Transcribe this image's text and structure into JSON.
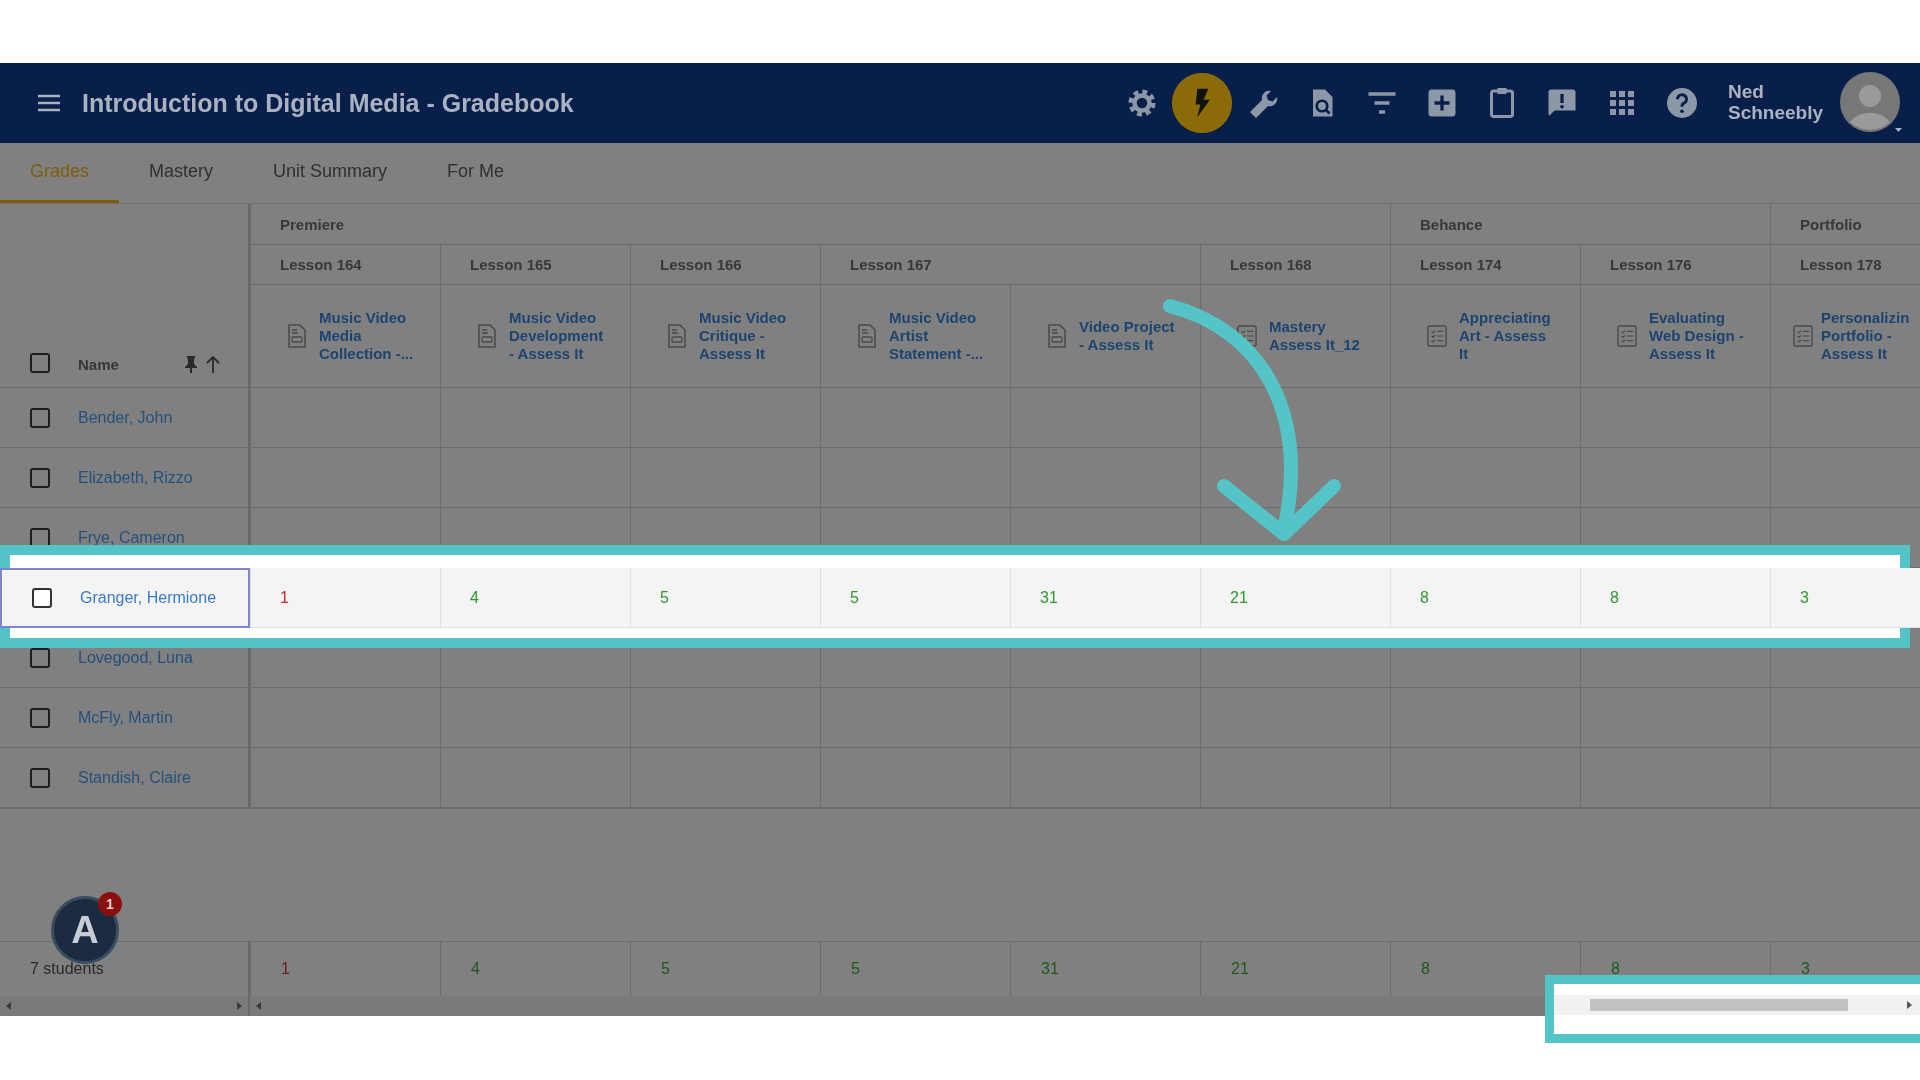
{
  "header": {
    "title": "Introduction to Digital Media - Gradebook",
    "user_name": "Ned Schneebly",
    "toolbar": [
      {
        "kind": "settings",
        "highlighted": false
      },
      {
        "kind": "lightning",
        "highlighted": true
      },
      {
        "kind": "wrench",
        "highlighted": false
      },
      {
        "kind": "document-search",
        "highlighted": false
      },
      {
        "kind": "filter",
        "highlighted": false
      },
      {
        "kind": "plus",
        "highlighted": false
      },
      {
        "kind": "clipboard",
        "highlighted": false
      },
      {
        "kind": "feedback",
        "highlighted": false
      },
      {
        "kind": "apps",
        "highlighted": false
      },
      {
        "kind": "help",
        "highlighted": false
      }
    ]
  },
  "tabs": [
    {
      "label": "Grades",
      "selected": true
    },
    {
      "label": "Mastery",
      "selected": false
    },
    {
      "label": "Unit Summary",
      "selected": false
    },
    {
      "label": "For Me",
      "selected": false
    }
  ],
  "table": {
    "name_header": "Name",
    "select_all_checked": false,
    "groups": [
      {
        "label": "Premiere",
        "lessons": [
          {
            "label": "Lesson 164",
            "assignments": [
              {
                "title": "Music Video Media Collection -...",
                "kind": "document"
              }
            ]
          },
          {
            "label": "Lesson 165",
            "assignments": [
              {
                "title": "Music Video Development - Assess It",
                "kind": "document"
              }
            ]
          },
          {
            "label": "Lesson 166",
            "assignments": [
              {
                "title": "Music Video Critique - Assess It",
                "kind": "document"
              }
            ]
          },
          {
            "label": "Lesson 167",
            "assignments": [
              {
                "title": "Music Video Artist Statement -...",
                "kind": "document"
              },
              {
                "title": "Video Project - Assess It",
                "kind": "document"
              }
            ]
          },
          {
            "label": "Lesson 168",
            "assignments": [
              {
                "title": "Mastery Assess It_12",
                "kind": "checklist"
              }
            ]
          }
        ]
      },
      {
        "label": "Behance",
        "lessons": [
          {
            "label": "Lesson 174",
            "assignments": [
              {
                "title": "Appreciating Art - Assess It",
                "kind": "checklist"
              }
            ]
          },
          {
            "label": "Lesson 176",
            "assignments": [
              {
                "title": "Evaluating Web Design - Assess It",
                "kind": "checklist"
              }
            ]
          }
        ]
      },
      {
        "label": "Portfolio",
        "lessons": [
          {
            "label": "Lesson 178",
            "assignments": [
              {
                "title": "Personalizin Portfolio - Assess It",
                "kind": "checklist"
              }
            ]
          }
        ]
      }
    ],
    "students": [
      {
        "name": "Bender, John",
        "checked": false,
        "selected": false
      },
      {
        "name": "Elizabeth, Rizzo",
        "checked": false,
        "selected": false
      },
      {
        "name": "Frye, Cameron",
        "checked": false,
        "selected": false
      },
      {
        "name": "Granger, Hermione",
        "checked": false,
        "selected": true,
        "scores": [
          {
            "value": "1",
            "color": "#c62828"
          },
          {
            "value": "4",
            "color": "#2e9a2e"
          },
          {
            "value": "5",
            "color": "#2e9a2e"
          },
          {
            "value": "5",
            "color": "#2e9a2e"
          },
          {
            "value": "31",
            "color": "#2e9a2e"
          },
          {
            "value": "21",
            "color": "#2e9a2e"
          },
          {
            "value": "8",
            "color": "#2e9a2e"
          },
          {
            "value": "8",
            "color": "#2e9a2e"
          },
          {
            "value": "3",
            "color": "#2e9a2e"
          }
        ]
      },
      {
        "name": "Lovegood, Luna",
        "checked": false,
        "selected": false
      },
      {
        "name": "McFly, Martin",
        "checked": false,
        "selected": false
      },
      {
        "name": "Standish, Claire",
        "checked": false,
        "selected": false
      }
    ],
    "footer": {
      "count": "7 students",
      "totals": [
        {
          "value": "1",
          "color": "#701818"
        },
        {
          "value": "4",
          "color": "#1e581e"
        },
        {
          "value": "5",
          "color": "#1e581e"
        },
        {
          "value": "5",
          "color": "#1e581e"
        },
        {
          "value": "31",
          "color": "#1e581e"
        },
        {
          "value": "21",
          "color": "#1e581e"
        },
        {
          "value": "8",
          "color": "#1e581e"
        },
        {
          "value": "8",
          "color": "#1e581e"
        },
        {
          "value": "3",
          "color": "#1e581e"
        }
      ]
    }
  },
  "badge": {
    "letter": "A",
    "count": "1"
  }
}
